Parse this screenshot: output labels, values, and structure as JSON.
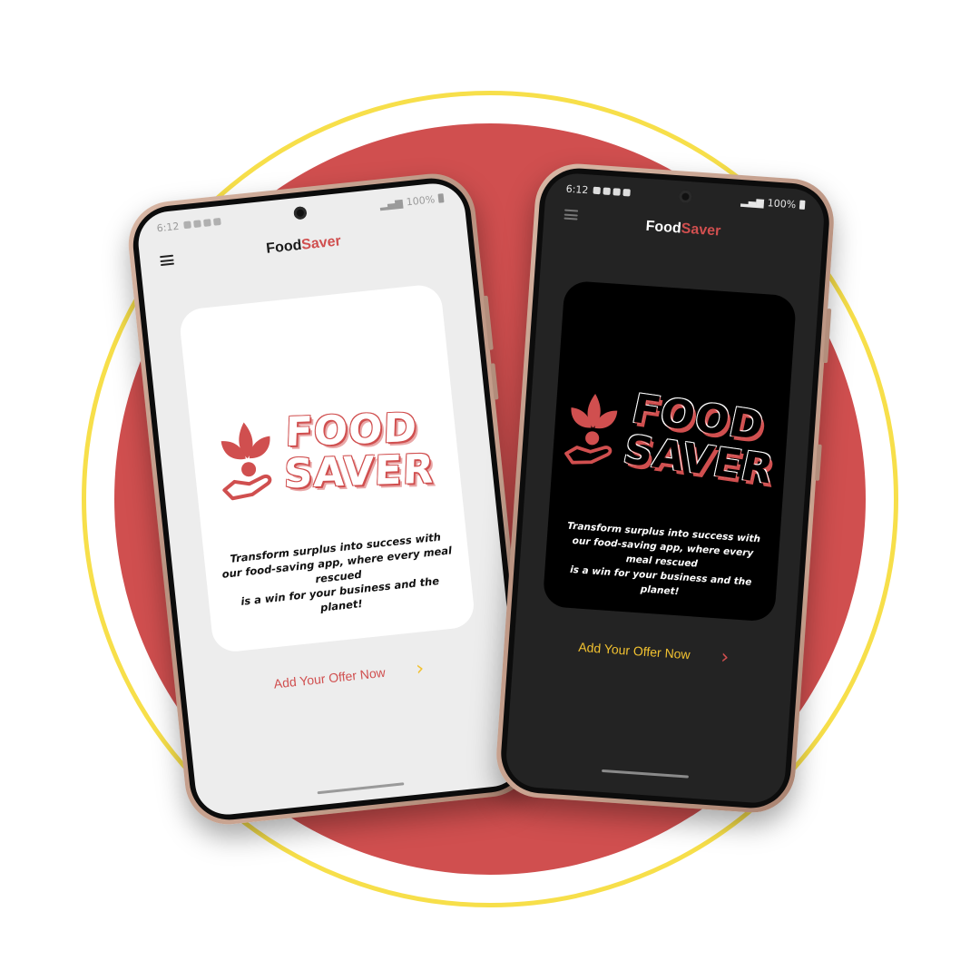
{
  "colors": {
    "accent_red": "#d04f4f",
    "accent_yellow": "#f2c230",
    "ring_yellow": "#f7df4a"
  },
  "phones": {
    "light": {
      "status": {
        "time": "6:12",
        "battery": "100%"
      },
      "app_title": {
        "part1": "Food",
        "part2": "Saver"
      },
      "logo": {
        "line1": "FOOD",
        "line2": "SAVER"
      },
      "tagline": {
        "line1": "Transform surplus into success with",
        "line2": "our food-saving app, where every meal rescued",
        "line3": "is a win for your business and the planet!"
      },
      "cta": {
        "label": "Add Your Offer Now",
        "icon": "chevron-right-icon"
      }
    },
    "dark": {
      "status": {
        "time": "6:12",
        "battery": "100%"
      },
      "app_title": {
        "part1": "Food",
        "part2": "Saver"
      },
      "logo": {
        "line1": "FOOD",
        "line2": "SAVER"
      },
      "tagline": {
        "line1": "Transform surplus into success with",
        "line2": "our food-saving app, where every meal rescued",
        "line3": "is a win for your business and the planet!"
      },
      "cta": {
        "label": "Add Your Offer Now",
        "icon": "chevron-right-icon"
      }
    }
  }
}
